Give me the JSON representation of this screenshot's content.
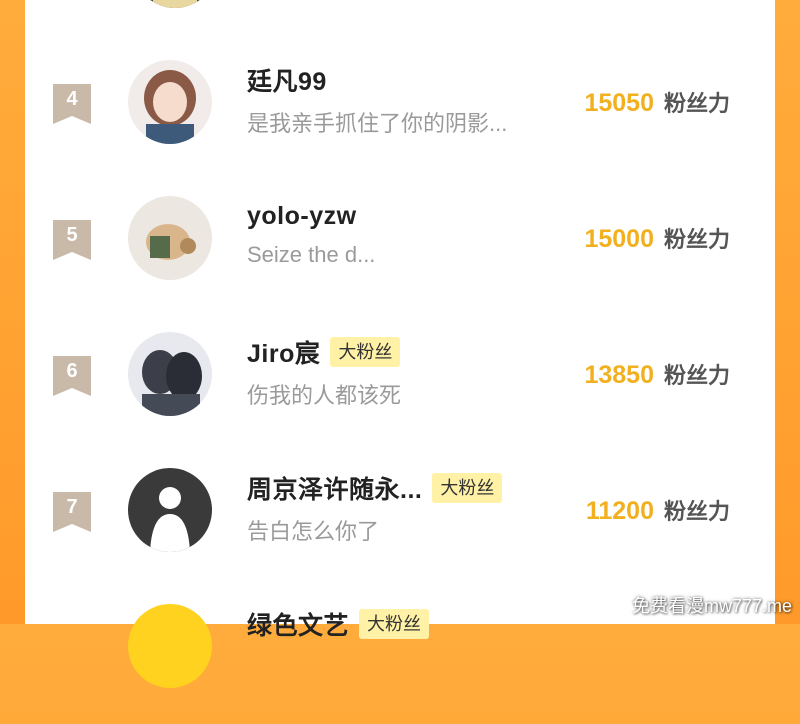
{
  "unit_label": "粉丝力",
  "users": [
    {
      "rank": "4",
      "name": "廷凡99",
      "badge": "",
      "motto": "是我亲手抓住了你的阴影...",
      "score": "15050"
    },
    {
      "rank": "5",
      "name": "yolo-yzw",
      "badge": "",
      "motto": "Seize the d...",
      "score": "15000"
    },
    {
      "rank": "6",
      "name": "Jiro宸",
      "badge": "大粉丝",
      "motto": "伤我的人都该死",
      "score": "13850"
    },
    {
      "rank": "7",
      "name": "周京泽许随永...",
      "badge": "大粉丝",
      "motto": "告白怎么你了",
      "score": "11200"
    },
    {
      "rank": "",
      "name": "绿色文艺",
      "badge": "大粉丝",
      "motto": "",
      "score": ""
    }
  ],
  "watermark": "免费看漫mw777.me",
  "colors": {
    "accent": "#ffa633",
    "score": "#f2b01e",
    "badge_bg": "#fff1a6",
    "rank_bg": "#c8b9a8"
  }
}
